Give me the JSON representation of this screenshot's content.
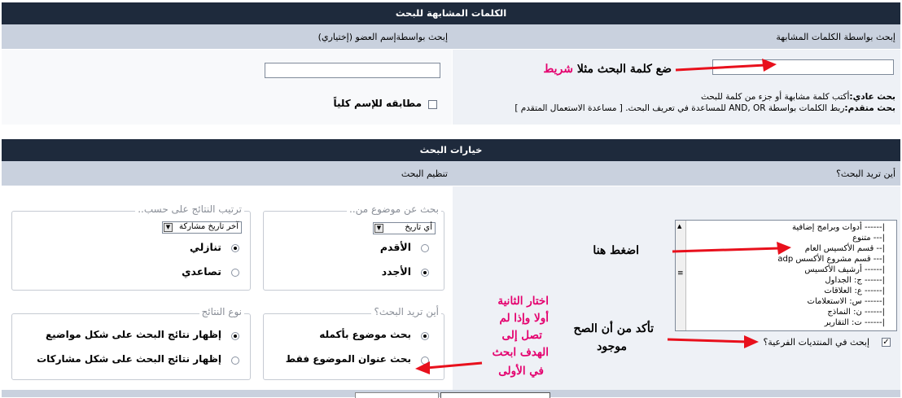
{
  "section1": {
    "title": "الكلمات المشابهة للبحث",
    "header_right": "إبحث بواسطة الكلمات المشابهة",
    "header_left": "إبحث بواسطةإسم العضو (إختياري)",
    "exact_name": "مطابقه للإسم كلياً",
    "normal_search_label": "بحث عادي:",
    "normal_search_text": "أكتب كلمة مشابهة أو جزء من كلمة للبحث",
    "advanced_search_label": "بحث متقدم:",
    "advanced_search_text": "ربط الكلمات بواسطة AND, OR للمساعدة في تعريف البحث. [ مساعدة الاستعمال المتقدم ]",
    "keyword_value": "",
    "member_value": ""
  },
  "section2": {
    "title": "خيارات البحث",
    "header_right": "أين تريد البحث؟",
    "header_left": "تنظيم البحث",
    "forums": [
      "|------ أدوات وبرامج إضافية",
      "|--- متنوع",
      "|-- قسم الأكسيس العام",
      "|--- قسم مشروع الأكسس adp",
      "|------ أرشيف الأكسيس",
      "|------ ج: الجداول",
      "|------ ع: العلاقات",
      "|------ س: الاستعلامات",
      "|------ ن: النماذج",
      "|------ ت: التقارير"
    ],
    "search_subforums": "إبحث في المنتديات الفرعية؟",
    "topic_from_legend": "بحث عن موضوع من..",
    "topic_from_select": "أي تاريخ",
    "oldest": "الأقدم",
    "newest": "الأجدد",
    "sort_legend": "ترتيب النتائج على حسب..",
    "sort_select": "آخر تاريخ مشاركة",
    "descending": "تنازلي",
    "ascending": "تصاعدي",
    "where_legend": "أين تريد البحث؟",
    "whole_topic": "بحث موضوع بأكمله",
    "title_only": "بحث عنوان الموضوع فقط",
    "result_type_legend": "نوع النتائج",
    "show_topics": "إظهار نتائج البحث على شكل مواضيع",
    "show_posts": "إظهار نتائج البحث على شكل مشاركات"
  },
  "annotations": {
    "put_keyword": "ضع كلمة البحث  مثلا",
    "example_word": "شريط",
    "click_here": "اضغط هنا",
    "make_sure_line1": "تأكد من أن الصح",
    "make_sure_line2": "موجود",
    "choose_second": [
      "اختار الثانية",
      "أولا وإذا لم",
      "تصل إلى",
      "الهدف ابحث",
      "في الأولى"
    ]
  },
  "colors": {
    "title_bg": "#1e2a3c",
    "header_bg": "#c9d1de",
    "arrow": "#e8101c",
    "pink_text": "#e4006e"
  }
}
